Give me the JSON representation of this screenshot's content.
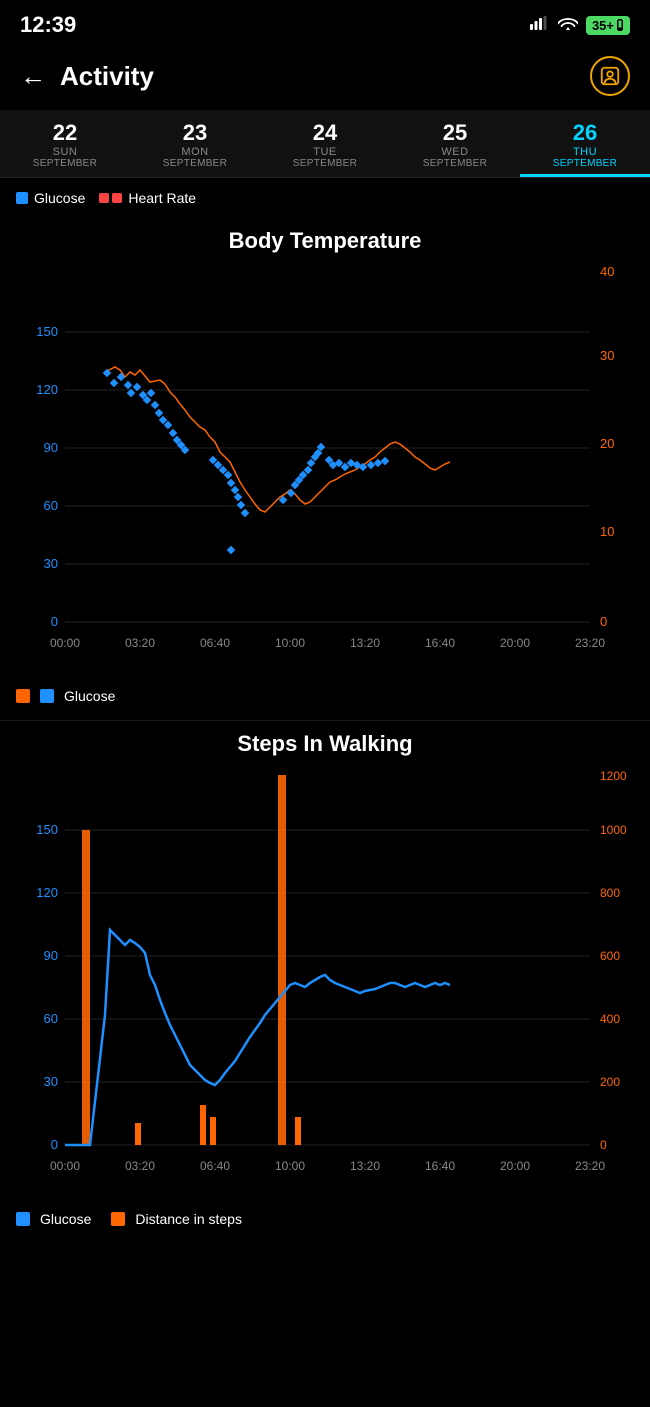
{
  "statusBar": {
    "time": "12:39",
    "battery": "35+",
    "batteryColor": "#4cd964"
  },
  "header": {
    "backLabel": "←",
    "title": "Activity",
    "profileIcon": "person-icon"
  },
  "dateNav": {
    "items": [
      {
        "number": "22",
        "day": "SUN",
        "month": "SEPTEMBER",
        "active": false
      },
      {
        "number": "23",
        "day": "MON",
        "month": "SEPTEMBER",
        "active": false
      },
      {
        "number": "24",
        "day": "TUE",
        "month": "SEPTEMBER",
        "active": false
      },
      {
        "number": "25",
        "day": "WED",
        "month": "SEPTEMBER",
        "active": false
      },
      {
        "number": "26",
        "day": "THU",
        "month": "SEPTEMBER",
        "active": true
      }
    ]
  },
  "legend": {
    "items": [
      {
        "color": "blue",
        "label": "Glucose"
      },
      {
        "color": "orange",
        "label": "Heart Rate"
      }
    ]
  },
  "bodyTempChart": {
    "title": "Body Temperature",
    "xLabels": [
      "00:00",
      "03:20",
      "06:40",
      "10:00",
      "13:20",
      "16:40",
      "20:00",
      "23:20"
    ],
    "yLeftLabels": [
      "0",
      "30",
      "60",
      "90",
      "120",
      "150"
    ],
    "yRightLabels": [
      "0",
      "10",
      "20",
      "30",
      "40"
    ],
    "legendItems": [
      {
        "color": "orange",
        "label": ""
      },
      {
        "color": "blue",
        "label": "Glucose"
      }
    ]
  },
  "stepsChart": {
    "title": "Steps In Walking",
    "xLabels": [
      "00:00",
      "03:20",
      "06:40",
      "10:00",
      "13:20",
      "16:40",
      "20:00",
      "23:20"
    ],
    "yLeftLabels": [
      "0",
      "30",
      "60",
      "90",
      "120",
      "150"
    ],
    "yRightLabels": [
      "0",
      "200",
      "400",
      "600",
      "800",
      "1000",
      "1200"
    ],
    "legendItems": [
      {
        "color": "blue",
        "label": "Glucose"
      },
      {
        "color": "orange",
        "label": "Distance in steps"
      }
    ]
  }
}
